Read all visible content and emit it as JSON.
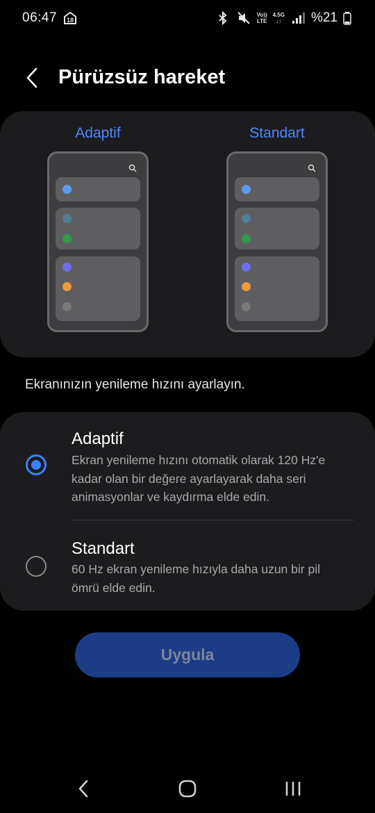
{
  "status_bar": {
    "time": "06:47",
    "notification_badge": "18",
    "volte_top": "Vo))",
    "volte_bottom": "LTE",
    "network_top": "4.5G",
    "network_bottom": "↓↑",
    "battery": "%21",
    "icons": [
      "calendar-icon",
      "bluetooth-icon",
      "mute-icon",
      "volte-icon",
      "signal-icon",
      "battery-icon"
    ]
  },
  "header": {
    "title": "Pürüzsüz hareket",
    "back_icon": "chevron-left-icon"
  },
  "preview": {
    "left_label": "Adaptif",
    "right_label": "Standart",
    "dot_colors": [
      "#5b9cf0",
      "#4f7d97",
      "#2f9a4e",
      "#6e6ff0",
      "#eb9a3d",
      "#7a7a7c"
    ]
  },
  "description": "Ekranınızın yenileme hızını ayarlayın.",
  "options": [
    {
      "title": "Adaptif",
      "description": "Ekran yenileme hızını otomatik olarak 120 Hz'e kadar olan bir değere ayarlayarak daha seri animasyonlar ve kaydırma elde edin.",
      "selected": true
    },
    {
      "title": "Standart",
      "description": "60 Hz ekran yenileme hızıyla daha uzun bir pil ömrü elde edin.",
      "selected": false
    }
  ],
  "apply_button": {
    "label": "Uygula"
  },
  "nav_bar": {
    "icons": [
      "back-icon",
      "home-icon",
      "recents-icon"
    ]
  },
  "colors": {
    "accent": "#3e80ff",
    "label_blue": "#4f86ff",
    "card_bg": "#1c1c1e",
    "button_bg": "#1c3c85"
  }
}
